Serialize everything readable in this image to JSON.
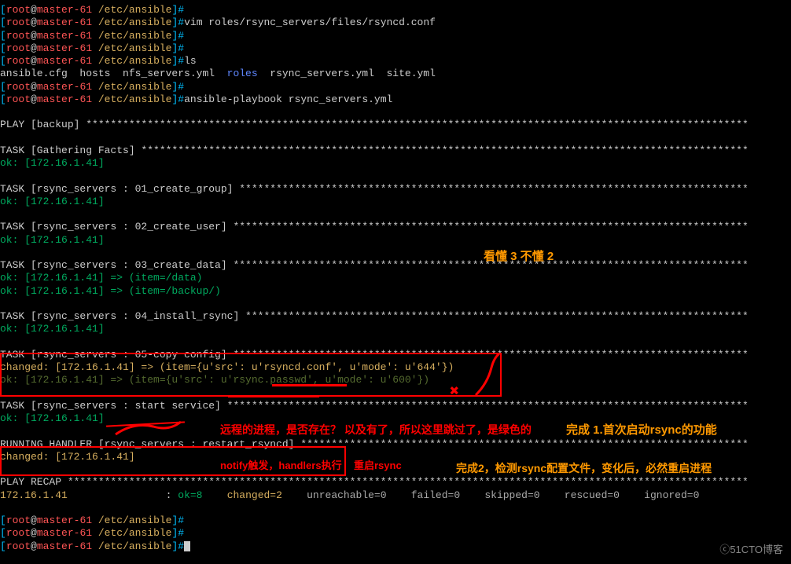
{
  "prompt": {
    "open": "[",
    "user": "root",
    "at": "@",
    "host": "master-61 ",
    "path": "/etc/ansible",
    "close": "]#"
  },
  "commands": {
    "blank": "",
    "vim": "vim roles/rsync_servers/files/rsyncd.conf",
    "ls": "ls",
    "playbook": "ansible-playbook rsync_servers.yml"
  },
  "ls_output": {
    "p1": "ansible.cfg  hosts  nfs_servers.yml  ",
    "roles": "roles",
    "p2": "  rsync_servers.yml  site.yml"
  },
  "play": {
    "header": "PLAY [backup] ************************************************************************************************************",
    "gather": "TASK [Gathering Facts] ***************************************************************************************************",
    "ok_ip": "ok: [172.16.1.41]",
    "t01": "TASK [rsync_servers : 01_create_group] ***********************************************************************************",
    "t02": "TASK [rsync_servers : 02_create_user] ************************************************************************************",
    "t03": "TASK [rsync_servers : 03_create_data] ************************************************************************************",
    "t03_item1": "ok: [172.16.1.41] => (item=/data)",
    "t03_item2": "ok: [172.16.1.41] => (item=/backup/)",
    "t04": "TASK [rsync_servers : 04_install_rsync] **********************************************************************************",
    "t05": "TASK [rsync_servers : 05-copy config] ************************************************************************************",
    "t05_changed": "changed: [172.16.1.41] => (item={u'src': u'rsyncd.conf', u'mode': u'644'})",
    "t05_ok": "ok: [172.16.1.41] => (item={u'src': u'rsync.passwd', u'mode': u'600'})",
    "t_start": "TASK [rsync_servers : start service] *************************************************************************************",
    "handler": "RUNNING HANDLER [rsync_servers : restart_rsyncd] *************************************************************************",
    "handler_changed": "changed: [172.16.1.41]",
    "recap_hdr": "PLAY RECAP ***************************************************************************************************************",
    "recap_host": "172.16.1.41",
    "recap_sep": "                : ",
    "recap_ok": "ok=8    ",
    "recap_changed": "changed=2    ",
    "recap_rest": "unreachable=0    failed=0    skipped=0    rescued=0    ignored=0"
  },
  "annotations": {
    "top_right": "看懂 3  不懂 2",
    "red_mid": "远程的进程，是否存在？  以及有了，所以这里跳过了，是绿色的",
    "orange_mid": "完成 1.首次启动rsync的功能",
    "red_handler": "notify触发，handlers执行",
    "red_handler2": "重启rsync",
    "orange_bottom": "完成2，检测rsync配置文件，变化后，必然重启进程"
  },
  "watermark": "ⓒ51CTO博客"
}
